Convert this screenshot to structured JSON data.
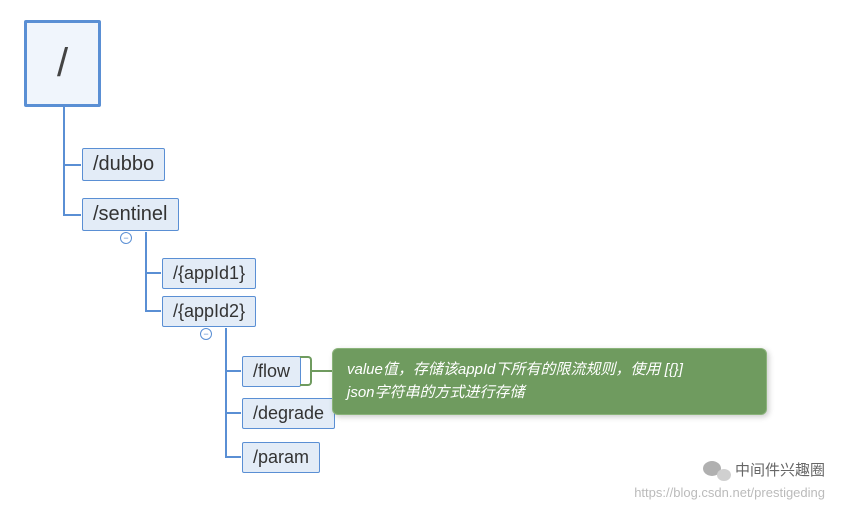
{
  "tree": {
    "root": "/",
    "level1": {
      "dubbo": "/dubbo",
      "sentinel": "/sentinel"
    },
    "level2": {
      "appid1": "/{appId1}",
      "appid2": "/{appId2}"
    },
    "level3": {
      "flow": "/flow",
      "degrade": "/degrade",
      "param": "/param"
    }
  },
  "tooltip": {
    "line1": "value值，存储该appId下所有的限流规则，使用 [{}]",
    "line2": "json字符串的方式进行存储"
  },
  "collapse_symbol": "−",
  "watermark": {
    "title": "中间件兴趣圈",
    "url": "https://blog.csdn.net/prestigeding"
  },
  "colors": {
    "node_bg": "#e3ecf7",
    "node_border": "#5a8fd4",
    "tooltip_bg": "#6f9b5f"
  }
}
